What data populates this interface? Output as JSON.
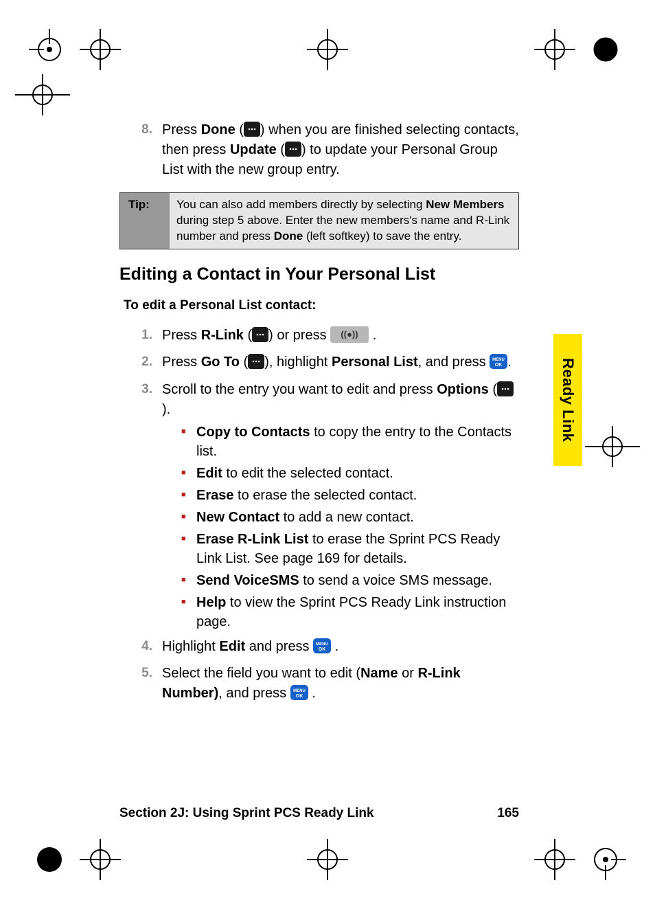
{
  "steps_top": {
    "num8": "8.",
    "s8_a": "Press ",
    "s8_b": "Done",
    "s8_c": " (",
    "s8_d": ") when you are finished selecting contacts, then press ",
    "s8_e": "Update",
    "s8_f": " (",
    "s8_g": ") to update your Personal Group List with the new group entry."
  },
  "tip": {
    "label": "Tip:",
    "body_a": "You can also add members directly by selecting ",
    "body_b": "New Members",
    "body_c": " during step 5 above. Enter the new members's name and R-Link number and press ",
    "body_d": "Done",
    "body_e": " (left softkey) to save the entry."
  },
  "heading": "Editing a Contact in Your Personal List",
  "subheading": "To edit a Personal List contact:",
  "steps": {
    "num1": "1.",
    "s1_a": "Press ",
    "s1_b": "R-Link",
    "s1_c": " (",
    "s1_d": ") or press ",
    "s1_e": ".",
    "num2": "2.",
    "s2_a": "Press ",
    "s2_b": "Go To",
    "s2_c": " (",
    "s2_d": "), highlight ",
    "s2_e": "Personal List",
    "s2_f": ", and press ",
    "s2_g": ".",
    "num3": "3.",
    "s3_a": "Scroll to the entry you want to edit and press ",
    "s3_b": "Options",
    "s3_c": " (",
    "s3_d": ").",
    "num4": "4.",
    "s4_a": "Highlight ",
    "s4_b": "Edit",
    "s4_c": " and press ",
    "s4_d": ".",
    "num5": "5.",
    "s5_a": "Select the field you want to edit (",
    "s5_b": "Name",
    "s5_c": " or ",
    "s5_d": "R-Link Number)",
    "s5_e": ", and press ",
    "s5_f": "."
  },
  "sub": {
    "i1_a": "Copy to Contacts",
    "i1_b": " to copy the entry to the Contacts list.",
    "i2_a": "Edit",
    "i2_b": " to edit the selected contact.",
    "i3_a": "Erase",
    "i3_b": " to erase the selected contact.",
    "i4_a": "New Contact",
    "i4_b": " to add a new contact.",
    "i5_a": "Erase R-Link List",
    "i5_b": " to erase the Sprint PCS Ready Link List. See page 169 for details.",
    "i6_a": "Send VoiceSMS",
    "i6_b": " to send a voice SMS message.",
    "i7_a": "Help",
    "i7_b": " to view the Sprint PCS Ready Link instruction page."
  },
  "side_tab": "Ready Link",
  "footer": {
    "section": "Section 2J: Using Sprint PCS Ready Link",
    "page": "165"
  }
}
